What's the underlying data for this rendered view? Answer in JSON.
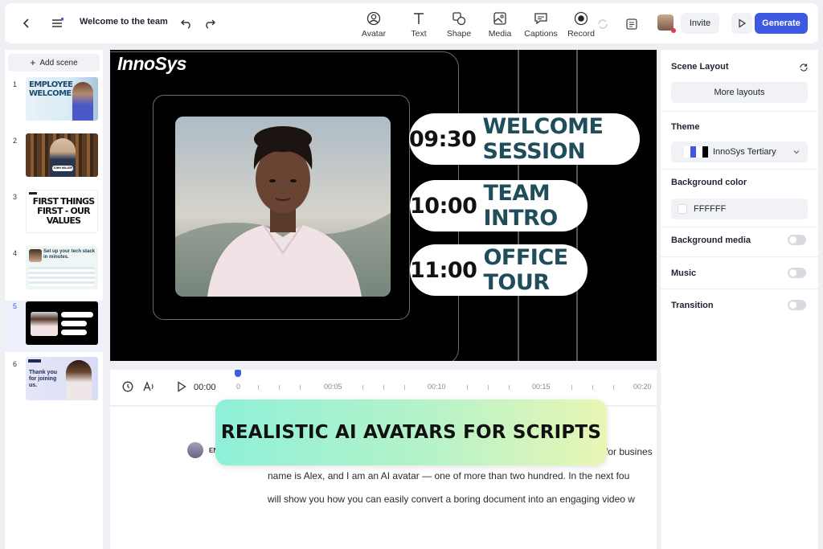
{
  "header": {
    "title": "Welcome to the team",
    "tools": [
      {
        "label": "Avatar",
        "icon": "avatar-icon"
      },
      {
        "label": "Text",
        "icon": "text-icon"
      },
      {
        "label": "Shape",
        "icon": "shape-icon"
      },
      {
        "label": "Media",
        "icon": "media-icon"
      },
      {
        "label": "Captions",
        "icon": "captions-icon"
      },
      {
        "label": "Record",
        "icon": "record-icon"
      }
    ],
    "invite_label": "Invite",
    "generate_label": "Generate"
  },
  "sidebar": {
    "add_scene_label": "Add scene",
    "scenes": [
      {
        "number": "1",
        "thumb_text": "EMPLOYEE WELCOME"
      },
      {
        "number": "2",
        "thumb_text": "JOHN MILLER"
      },
      {
        "number": "3",
        "thumb_text": "FIRST THINGS FIRST - OUR VALUES"
      },
      {
        "number": "4",
        "thumb_text": "Set up your tech stack in minutes."
      },
      {
        "number": "5",
        "thumb_text": ""
      },
      {
        "number": "6",
        "thumb_text": "Thank you for joining us."
      }
    ],
    "active_scene": 5
  },
  "canvas": {
    "logo": "InnoSys",
    "agenda": [
      {
        "time": "09:30",
        "label": "WELCOME SESSION"
      },
      {
        "time": "10:00",
        "label": "TEAM INTRO"
      },
      {
        "time": "11:00",
        "label": "OFFICE TOUR"
      }
    ]
  },
  "timeline": {
    "current_time": "00:00",
    "ticks": [
      "0",
      "00:05",
      "00:10",
      "00:15",
      "00:20"
    ]
  },
  "script": {
    "speaker_tag": "EN",
    "lines": [
      "for busines",
      "name is Alex, and I am an AI avatar — one of more than two hundred. In the next fou",
      "will show you how you can easily convert a boring document into an engaging video w"
    ]
  },
  "banner": {
    "text": "REALISTIC AI AVATARS FOR SCRIPTS"
  },
  "properties": {
    "scene_layout_label": "Scene Layout",
    "more_layouts_label": "More layouts",
    "theme_label": "Theme",
    "theme_value": "InnoSys Tertiary",
    "background_color_label": "Background color",
    "background_color_value": "FFFFFF",
    "background_media_label": "Background media",
    "music_label": "Music",
    "transition_label": "Transition"
  },
  "colors": {
    "accent": "#3d5ae0",
    "agenda_label": "#1f4e5a",
    "theme_swatch_1": "#3d5ae0",
    "theme_swatch_2": "#000000"
  }
}
